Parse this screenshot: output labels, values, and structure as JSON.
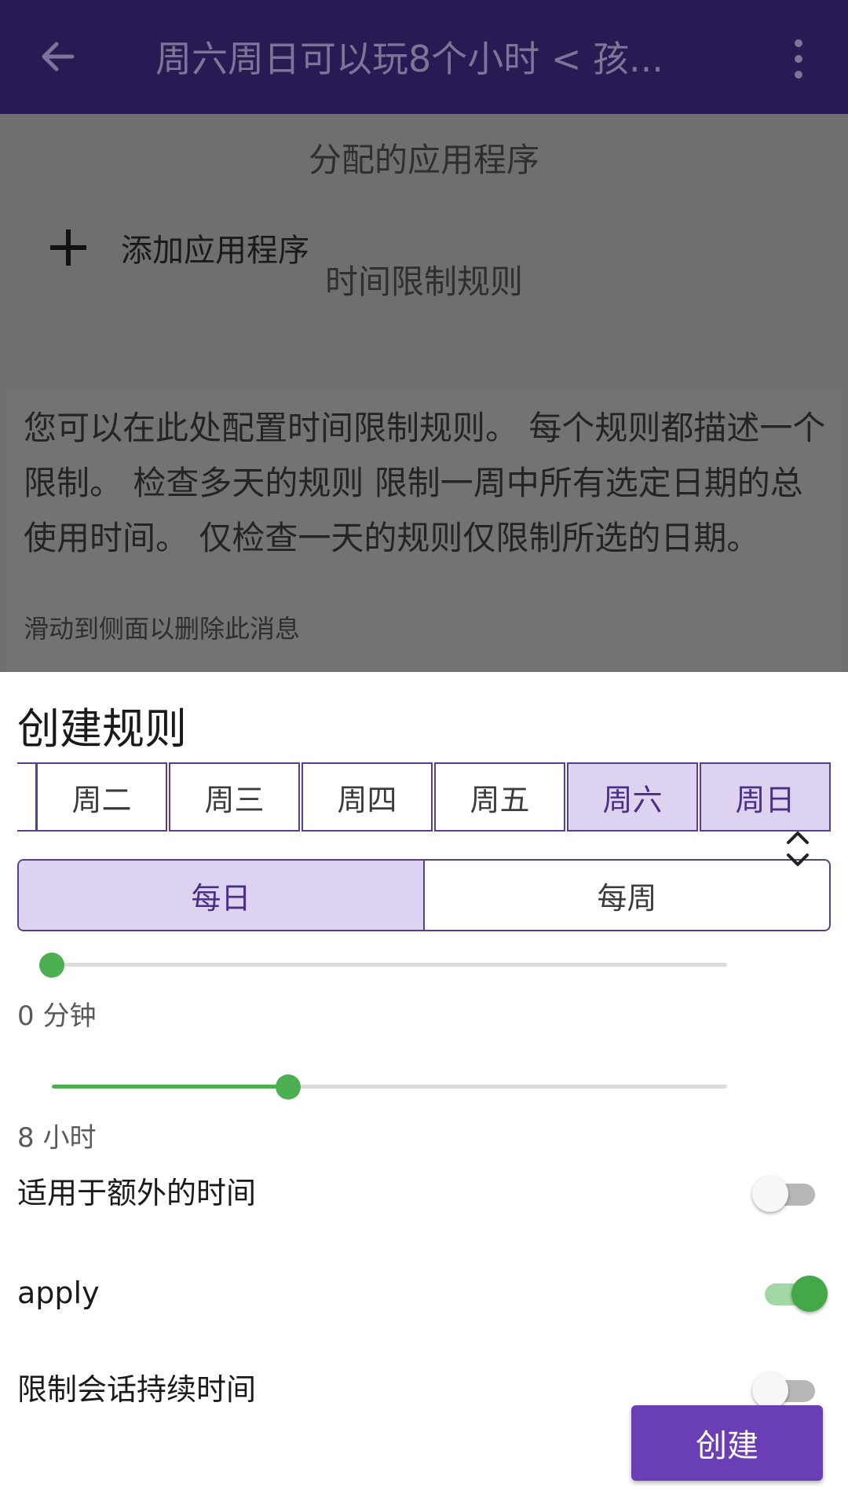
{
  "app_bar": {
    "title": "周六周日可以玩8个小时 < 孩..."
  },
  "background": {
    "assigned_apps_heading": "分配的应用程序",
    "add_app_label": "添加应用程序",
    "time_rules_heading": "时间限制规则",
    "info_text": "您可以在此处配置时间限制规则。 每个规则都描述一个限制。 检查多天的规则 限制一周中所有选定日期的总使用时间。 仅检查一天的规则仅限制所选的日期。",
    "info_hint": "滑动到侧面以删除此消息"
  },
  "sheet": {
    "title": "创建规则",
    "days": [
      {
        "label": "周二",
        "selected": false
      },
      {
        "label": "周三",
        "selected": false
      },
      {
        "label": "周四",
        "selected": false
      },
      {
        "label": "周五",
        "selected": false
      },
      {
        "label": "周六",
        "selected": true
      },
      {
        "label": "周日",
        "selected": true
      }
    ],
    "period": {
      "options": [
        "每日",
        "每周"
      ],
      "selected": "每日"
    },
    "slider1": {
      "label": "0 分钟",
      "value_fraction": 0.0
    },
    "slider2": {
      "label": "8 小时",
      "value_fraction": 0.35
    },
    "toggles": [
      {
        "label": "适用于额外的时间",
        "on": false
      },
      {
        "label": "apply",
        "on": true
      },
      {
        "label": "限制会话持续时间",
        "on": false
      }
    ],
    "create_label": "创建"
  },
  "colors": {
    "app_bar": "#2a1a54",
    "accent": "#6a3fb5",
    "selected_fill": "#ddd3f0",
    "slider_green": "#4caf50"
  }
}
